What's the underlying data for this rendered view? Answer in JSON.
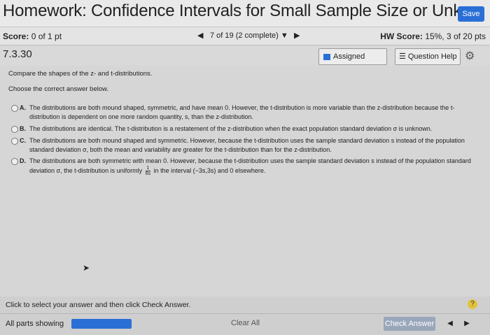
{
  "header": {
    "title": "Homework: Confidence Intervals for Small Sample Size or Unkn",
    "save_label": "Save"
  },
  "scorebar": {
    "score_label": "Score:",
    "score_value": "0 of 1 pt",
    "progress": "7 of 19 (2 complete)",
    "hw_score_label": "HW Score:",
    "hw_score_value": "15%, 3 of 20 pts"
  },
  "question": {
    "number": "7.3.30",
    "assigned_media_label": "Assigned Media",
    "question_help_label": "Question Help",
    "prompt": "Compare the shapes of the z- and t-distributions.",
    "instruction": "Choose the correct answer below.",
    "options": [
      {
        "letter": "A.",
        "text": "The distributions are both mound shaped, symmetric, and have mean 0. However, the t-distribution is more variable than the z-distribution because the t-distribution is dependent on one more random quantity, s, than the z-distribution."
      },
      {
        "letter": "B.",
        "text": "The distributions are identical. The t-distribution is a restatement of the z-distribution when the exact population standard deviation σ is unknown."
      },
      {
        "letter": "C.",
        "text": "The distributions are both mound shaped and symmetric. However, because the t-distribution uses the sample standard deviation s instead of the population standard deviation σ, both the mean and variability are greater for the t-distribution than for the z-distribution."
      },
      {
        "letter": "D.",
        "text_before": "The distributions are both symmetric with mean 0. However, because the t-distribution uses the sample standard deviation s instead of the population standard deviation σ, the t-distribution is uniformly",
        "frac_num": "1",
        "frac_den": "6s",
        "text_after": "in the interval (−3s,3s) and 0 elsewhere."
      }
    ]
  },
  "footer": {
    "instruction": "Click to select your answer and then click Check Answer.",
    "help_glyph": "?",
    "all_parts_label": "All parts showing",
    "clear_all_label": "Clear All",
    "check_answer_label": "Check Answer"
  }
}
